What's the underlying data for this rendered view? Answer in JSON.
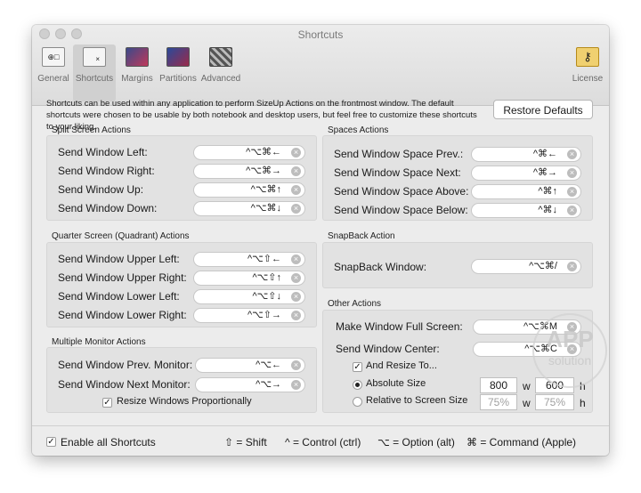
{
  "window": {
    "title": "Shortcuts"
  },
  "toolbar": [
    {
      "label": "General",
      "icon": "general-icon"
    },
    {
      "label": "Shortcuts",
      "icon": "shortcuts-icon"
    },
    {
      "label": "Margins",
      "icon": "margins-icon"
    },
    {
      "label": "Partitions",
      "icon": "partitions-icon"
    },
    {
      "label": "Advanced",
      "icon": "advanced-icon"
    },
    {
      "label": "License",
      "icon": "key-icon"
    }
  ],
  "description": "Shortcuts can be used within any application to perform SizeUp Actions on the frontmost window. The default shortcuts were chosen to be usable by both notebook and desktop users, but feel free to customize these shortcuts to your liking.",
  "restore_defaults": "Restore Defaults",
  "split": {
    "title": "Split Screen Actions",
    "rows": [
      {
        "label": "Send Window Left:",
        "shortcut": "^⌥⌘←"
      },
      {
        "label": "Send Window Right:",
        "shortcut": "^⌥⌘→"
      },
      {
        "label": "Send Window Up:",
        "shortcut": "^⌥⌘↑"
      },
      {
        "label": "Send Window Down:",
        "shortcut": "^⌥⌘↓"
      }
    ]
  },
  "quarter": {
    "title": "Quarter Screen (Quadrant) Actions",
    "rows": [
      {
        "label": "Send Window Upper Left:",
        "shortcut": "^⌥⇧←"
      },
      {
        "label": "Send Window Upper Right:",
        "shortcut": "^⌥⇧↑"
      },
      {
        "label": "Send Window Lower Left:",
        "shortcut": "^⌥⇧↓"
      },
      {
        "label": "Send Window Lower Right:",
        "shortcut": "^⌥⇧→"
      }
    ]
  },
  "monitor": {
    "title": "Multiple Monitor Actions",
    "rows": [
      {
        "label": "Send Window Prev. Monitor:",
        "shortcut": "^⌥←"
      },
      {
        "label": "Send Window Next Monitor:",
        "shortcut": "^⌥→"
      }
    ],
    "resize_label": "Resize Windows Proportionally",
    "resize_checked": true
  },
  "spaces": {
    "title": "Spaces Actions",
    "rows": [
      {
        "label": "Send Window Space Prev.:",
        "shortcut": "^⌘←"
      },
      {
        "label": "Send Window Space Next:",
        "shortcut": "^⌘→"
      },
      {
        "label": "Send Window Space Above:",
        "shortcut": "^⌘↑"
      },
      {
        "label": "Send Window Space Below:",
        "shortcut": "^⌘↓"
      }
    ]
  },
  "snapback": {
    "title": "SnapBack Action",
    "rows": [
      {
        "label": "SnapBack Window:",
        "shortcut": "^⌥⌘/"
      }
    ]
  },
  "other": {
    "title": "Other Actions",
    "rows": [
      {
        "label": "Make Window Full Screen:",
        "shortcut": "^⌥⌘M"
      },
      {
        "label": "Send Window Center:",
        "shortcut": "^⌥⌘C"
      }
    ],
    "and_resize_label": "And Resize To...",
    "and_resize_checked": true,
    "absolute_label": "Absolute Size",
    "absolute_w": "800",
    "absolute_h": "600",
    "relative_label": "Relative to Screen Size",
    "relative_w": "75%",
    "relative_h": "75%",
    "w_unit": "w",
    "h_unit": "h"
  },
  "footer": {
    "enable_label": "Enable all Shortcuts",
    "enable_checked": true,
    "legend": [
      "⇧ = Shift",
      "^ = Control (ctrl)",
      "⌥ = Option (alt)",
      "⌘ = Command (Apple)"
    ]
  },
  "watermark": {
    "line1": "APP",
    "line2": "solution"
  },
  "colors": {
    "accent_margins": "#c0395a",
    "accent_partitions": "#2a4a9a",
    "license_key": "#e7b52a"
  }
}
